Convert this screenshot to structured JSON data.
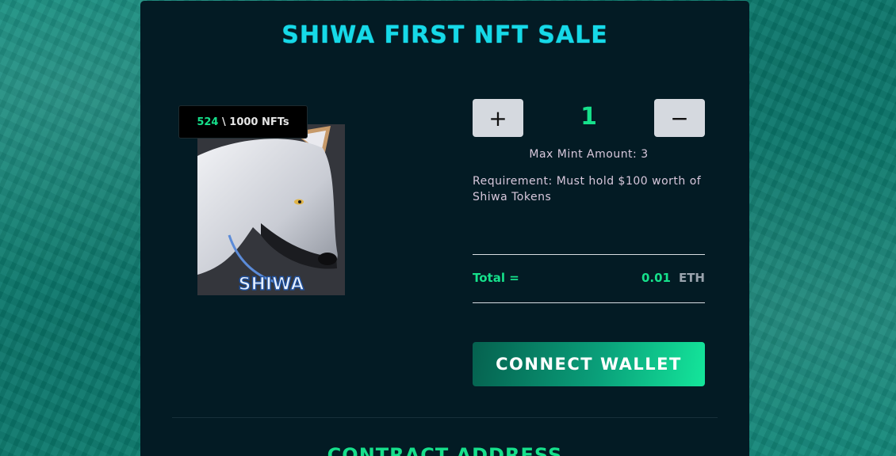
{
  "sale": {
    "title": "SHIWA FIRST NFT SALE",
    "minted_count": "524",
    "supply_text": " \\ 1000 NFTs",
    "art_logo_text": "SHIWA"
  },
  "mint": {
    "plus_label": "+",
    "minus_label": "−",
    "quantity": "1",
    "max_mint": "Max Mint Amount: 3",
    "requirement": "Requirement: Must hold $100 worth of Shiwa Tokens",
    "total_label": "Total =",
    "total_amount": "0.01",
    "total_unit": "ETH",
    "connect_label": "CONNECT WALLET"
  },
  "contract": {
    "heading": "CONTRACT ADDRESS"
  },
  "colors": {
    "title": "#16d9e8",
    "accent_green": "#16e08b",
    "card_bg": "#031b24",
    "page_bg": "#0b7468",
    "stepper_bg": "#d5d9df"
  },
  "icons": {
    "nft_image": "wolf-illustration"
  }
}
